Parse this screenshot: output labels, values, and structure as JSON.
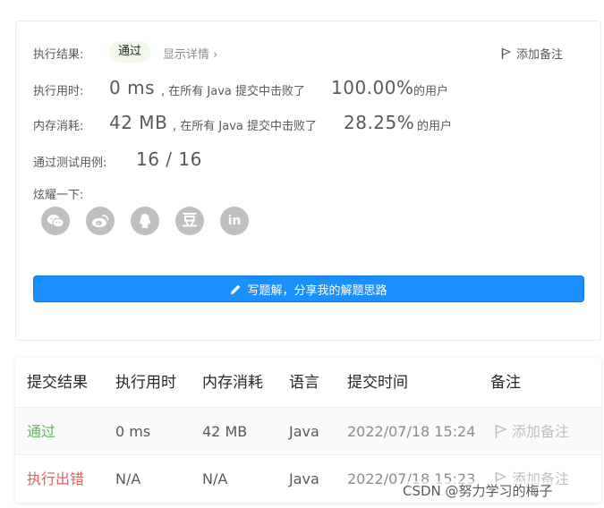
{
  "result": {
    "label": "执行结果:",
    "status": "通过",
    "detail_link": "显示详情",
    "detail_arrow": "›",
    "add_note": "添加备注"
  },
  "runtime": {
    "label": "执行用时:",
    "value": "0 ms",
    "prefix": ", 在所有 Java 提交中击败了",
    "percent": "100.00%",
    "suffix": "的用户"
  },
  "memory": {
    "label": "内存消耗:",
    "value": "42 MB",
    "prefix": ", 在所有 Java 提交中击败了",
    "percent": "28.25%",
    "suffix": "的用户"
  },
  "testcases": {
    "label": "通过测试用例:",
    "value": "16 / 16"
  },
  "share": {
    "label": "炫耀一下:",
    "icons": [
      "wechat-icon",
      "weibo-icon",
      "qq-icon",
      "douban-icon",
      "linkedin-icon"
    ],
    "douban_glyph": "豆",
    "linkedin_glyph": "in"
  },
  "write_solution": "写题解，分享我的解题思路",
  "submissions": {
    "headers": [
      "提交结果",
      "执行用时",
      "内存消耗",
      "语言",
      "提交时间",
      "备注"
    ],
    "rows": [
      {
        "result": "通过",
        "runtime": "0 ms",
        "memory": "42 MB",
        "language": "Java",
        "time": "2022/07/18 15:24",
        "note": "添加备注"
      },
      {
        "result": "执行出错",
        "runtime": "N/A",
        "memory": "N/A",
        "language": "Java",
        "time": "2022/07/18 15:23",
        "note": "添加备注"
      }
    ]
  },
  "watermark": "CSDN @努力学习的梅子",
  "colors": {
    "accent": "#1a90ff",
    "pass": "#5cb85c",
    "fail": "#e65c5c",
    "badge_bg": "#f1f8ec",
    "share_icon_bg": "#bfbfbf"
  }
}
